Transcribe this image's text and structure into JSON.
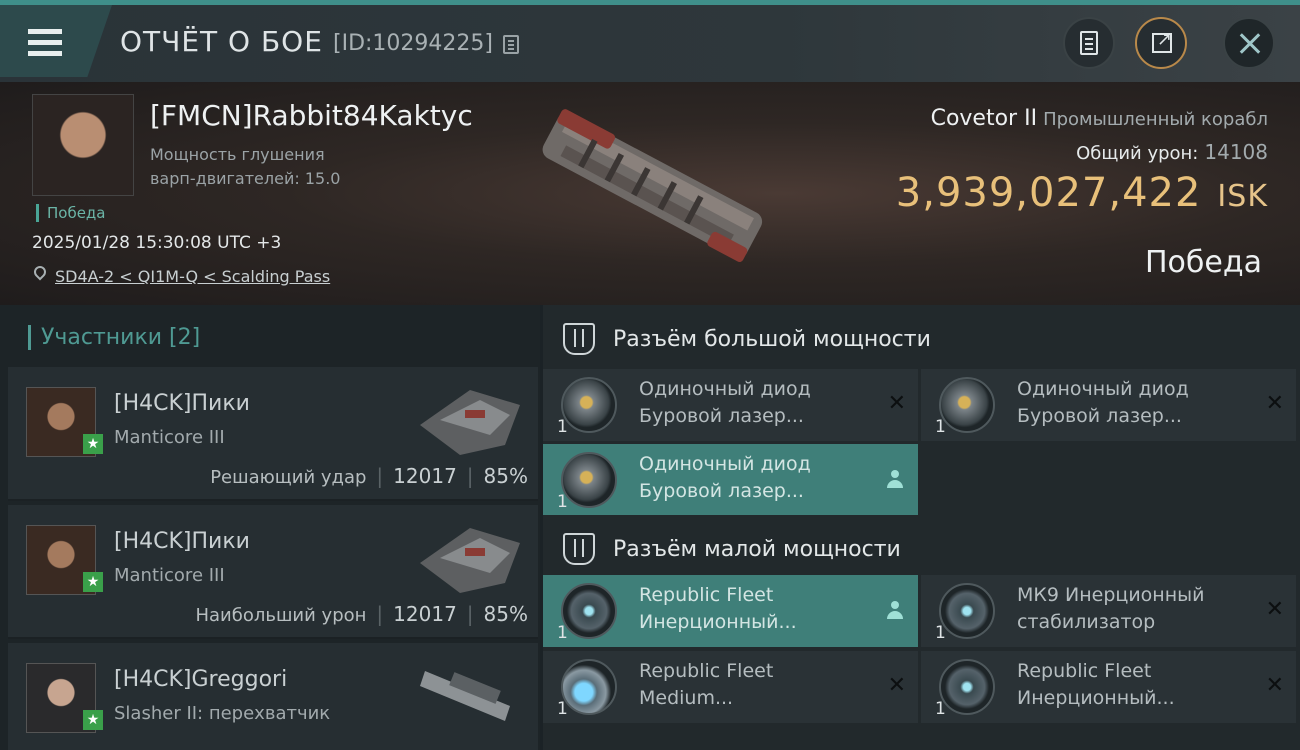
{
  "topbar": {
    "title": "ОТЧЁТ О БОЕ",
    "report_id": "[ID:10294225]",
    "icons": [
      "menu-icon",
      "copy-icon",
      "clipboard-icon",
      "share-icon",
      "close-icon"
    ]
  },
  "victim": {
    "name": "[FMCN]Rabbit84Kaktyc",
    "scram_label": "Мощность глушения варп-двигателей: 15.0",
    "result_badge": "Победа",
    "datetime": "2025/01/28 15:30:08 UTC +3",
    "location": "SD4A-2 < QI1M-Q < Scalding Pass",
    "ship_name": "Covetor II",
    "ship_class": "Промышленный корабл",
    "total_damage_label": "Общий урон:",
    "total_damage": "14108",
    "isk_value": "3,939,027,422",
    "isk_currency": "ISK",
    "outcome": "Победа"
  },
  "participants": {
    "title": "Участники [2]",
    "rows": [
      {
        "name": "[H4CK]Пики",
        "ship": "Manticore III",
        "label": "Решающий удар",
        "damage": "12017",
        "percent": "85%"
      },
      {
        "name": "[H4CK]Пики",
        "ship": "Manticore III",
        "label": "Наибольший урон",
        "damage": "12017",
        "percent": "85%"
      },
      {
        "name": "[H4CK]Greggori",
        "ship": "Slasher II: перехватчик"
      }
    ]
  },
  "fitting": {
    "high": {
      "title": "Разъём большой мощности",
      "modules": [
        {
          "line1": "Одиночный диод",
          "line2": "Буровой лазер...",
          "qty": "1"
        },
        {
          "line1": "Одиночный диод",
          "line2": "Буровой лазер...",
          "qty": "1"
        },
        {
          "line1": "Одиночный диод",
          "line2": "Буровой лазер...",
          "qty": "1"
        }
      ]
    },
    "low": {
      "title": "Разъём малой мощности",
      "modules": [
        {
          "line1": "Republic Fleet",
          "line2": "Инерционный...",
          "qty": "1"
        },
        {
          "line1": "МК9 Инерционный",
          "line2": "стабилизатор",
          "qty": "1"
        },
        {
          "line1": "Republic Fleet",
          "line2": "Medium...",
          "qty": "1"
        },
        {
          "line1": "Republic Fleet",
          "line2": "Инерционный...",
          "qty": "1"
        }
      ]
    }
  },
  "colors": {
    "accent": "#3f8f8a",
    "isk": "#e8c07a",
    "active_module": "#3f7f79",
    "victory": "#6bb5a7"
  }
}
